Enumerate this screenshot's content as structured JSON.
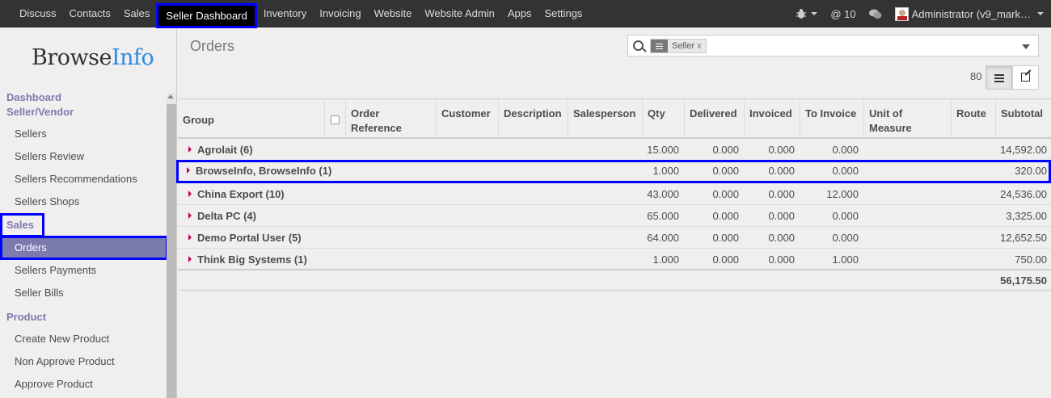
{
  "topnav": {
    "items": [
      "Discuss",
      "Contacts",
      "Sales",
      "Seller Dashboard",
      "Inventory",
      "Invoicing",
      "Website",
      "Website Admin",
      "Apps",
      "Settings"
    ],
    "active": "Seller Dashboard",
    "messages_count": "@ 10",
    "user": "Administrator (v9_mark…"
  },
  "sidebar": {
    "logo_browse": "Browse",
    "logo_info": "Info",
    "sections": [
      {
        "title": "Dashboard Seller/Vendor",
        "items": [
          "Sellers",
          "Sellers Review",
          "Sellers Recommendations",
          "Sellers Shops"
        ]
      },
      {
        "title": "Sales",
        "items": [
          "Orders",
          "Sellers Payments",
          "Seller Bills"
        ]
      },
      {
        "title": "Product",
        "items": [
          "Create New Product",
          "Non Approve Product",
          "Approve Product"
        ]
      }
    ],
    "active_item": "Orders"
  },
  "control": {
    "title": "Orders",
    "facet_label": "Seller",
    "facet_remove": "x",
    "record_count": "80"
  },
  "table": {
    "headers": [
      "Group",
      "Order Reference",
      "Customer",
      "Description",
      "Salesperson",
      "Qty",
      "Delivered",
      "Invoiced",
      "To Invoice",
      "Unit of Measure",
      "Route",
      "Subtotal"
    ],
    "groups": [
      {
        "name": "Agrolait (6)",
        "qty": "15.000",
        "delivered": "0.000",
        "invoiced": "0.000",
        "to_invoice": "0.000",
        "subtotal": "14,592.00"
      },
      {
        "name": "BrowseInfo, BrowseInfo (1)",
        "qty": "1.000",
        "delivered": "0.000",
        "invoiced": "0.000",
        "to_invoice": "0.000",
        "subtotal": "320.00"
      },
      {
        "name": "China Export (10)",
        "qty": "43.000",
        "delivered": "0.000",
        "invoiced": "0.000",
        "to_invoice": "12.000",
        "subtotal": "24,536.00"
      },
      {
        "name": "Delta PC (4)",
        "qty": "65.000",
        "delivered": "0.000",
        "invoiced": "0.000",
        "to_invoice": "0.000",
        "subtotal": "3,325.00"
      },
      {
        "name": "Demo Portal User (5)",
        "qty": "64.000",
        "delivered": "0.000",
        "invoiced": "0.000",
        "to_invoice": "0.000",
        "subtotal": "12,652.50"
      },
      {
        "name": "Think Big Systems (1)",
        "qty": "1.000",
        "delivered": "0.000",
        "invoiced": "0.000",
        "to_invoice": "1.000",
        "subtotal": "750.00"
      }
    ],
    "total_subtotal": "56,175.50"
  }
}
